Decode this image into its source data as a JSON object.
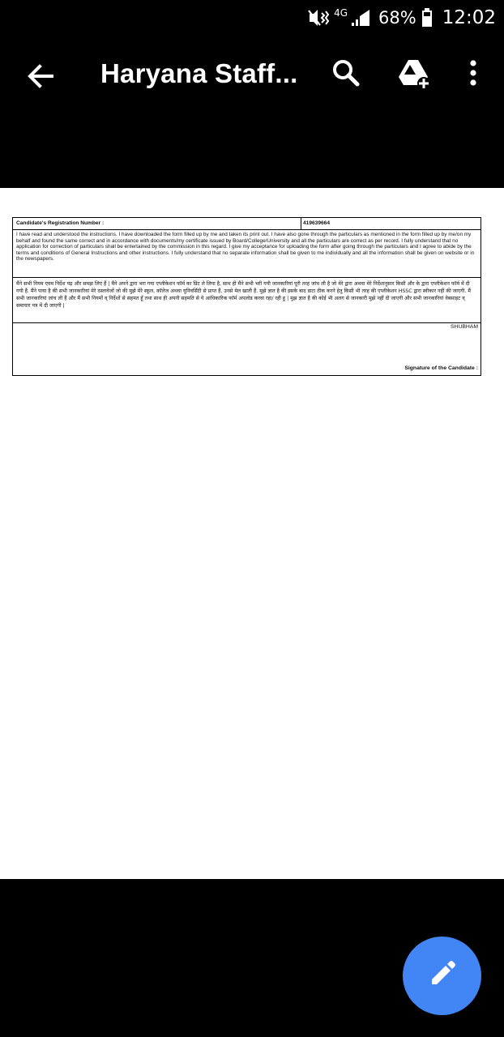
{
  "status_bar": {
    "network": "4G",
    "battery": "68%",
    "time": "12:02"
  },
  "app_bar": {
    "title": "Haryana Staff...",
    "icons": [
      "back-arrow-icon",
      "search-icon",
      "drive-add-icon",
      "more-vert-icon"
    ]
  },
  "document": {
    "registration_label": "Candidate's Registration Number :",
    "registration_value": "419639664",
    "declaration_english": "I have read and understood the instructions. I have downloaded the form filled up by me and taken its print out. I have also gone through the particulars as mentioned in the form filled up by me/on my behalf and found the same correct and in accordance with documents/my certificate issued by Board/College/University and all the particulars are correct as per record. I fully understand that no application for correction of particulars shall be entertained by the commission in this regard. I give my acceptance for uploading the form after going through the particulars and I agree to abide by the terms and conditions of General Instructions and other instructions. I fully understand that no separate information shall be given to me individually and all the information shall be given on website or in the newspapers.",
    "declaration_hindi": "मैंने सभी नियम एवम निर्देश पढ़ और समझ लिए हैं | मैंने अपने द्वारा भरा गया एप्लीकेशन फॉर्म का प्रिंट ले लिया है, साथ ही मैंने सभी भरी गयी जानकारियां पूरी तरह जांच ली है जो मेरे द्वारा अथवा मेरे निर्देशानुसार किसी और के द्वारा एप्लीकेशन फॉर्म में दी गयी हैं. मैंने पाया है की सभी जानकारियां मेरे दस्तावेजों जो की मुझे मेरे स्कूल, कॉलेज अथवा यूनिवर्सिटी से प्राप्त हैं, उनसे मेल खाती हैं. मुझे ज्ञात है की इसके बाद डाटा ठीक करने हेतु किसी भी तरह की एप्लीकेशन HSSC द्वारा स्वीकार नहीं की जाएगी. मैं सभी जानकारियां जांच ली हैं और मैं सभी नियमों व् निर्देशों से सहमत हूँ तथा साथ ही अपनी सहमति से ये आधिकारिक फॉर्म अपलोड करवा रहा/ रही हु | मुझ ज्ञात है की कोई भी अलग से जानकारी मुझे नहीं दी जाएगी और सभी जानकारियां वेबसाइट व् समाचार पत्र में दी जाएगी |",
    "candidate_name": "SHUBHAM",
    "signature_label": "Signature of the Candidate :"
  },
  "fab": {
    "icon": "pencil-edit-icon",
    "color": "#4285f4"
  }
}
